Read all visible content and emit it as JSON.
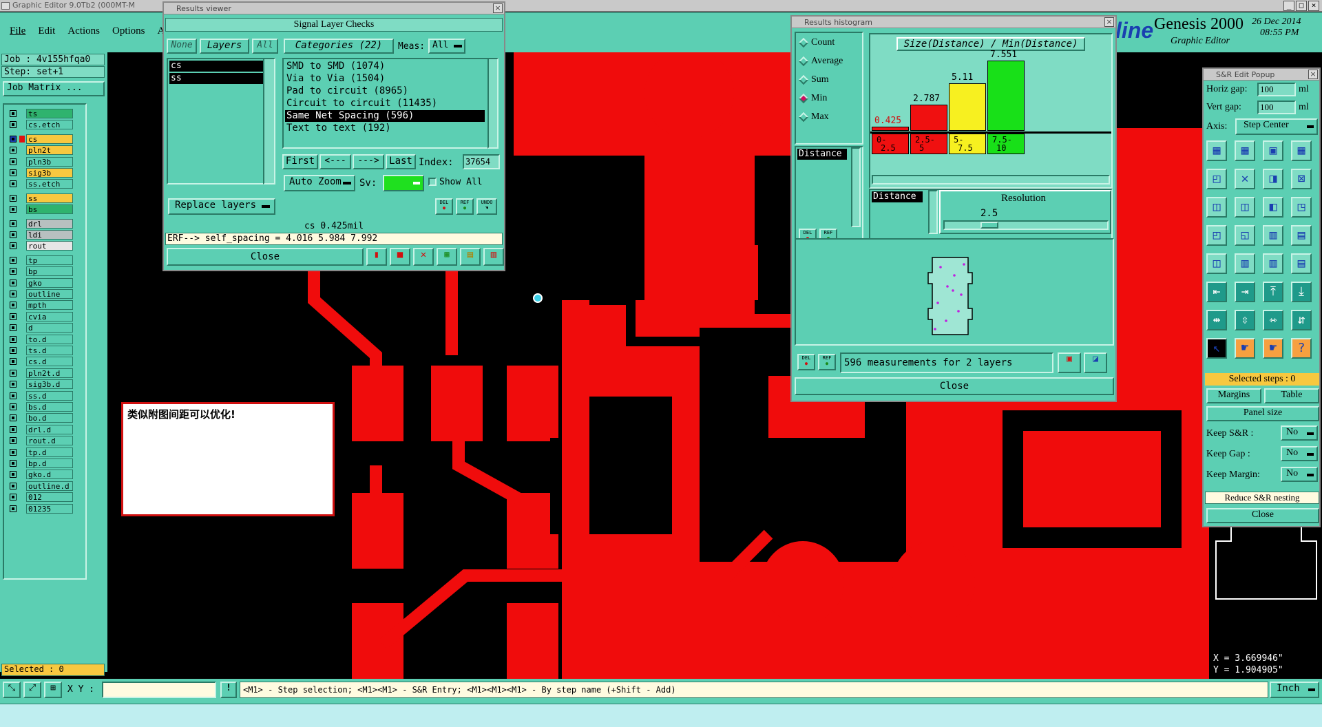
{
  "titlebar": {
    "title": "Graphic Editor 9.0Tb2 (000MT-M",
    "buttons": [
      "_",
      "□",
      "×"
    ]
  },
  "menu": {
    "items": [
      "File",
      "Edit",
      "Actions",
      "Options",
      "A"
    ]
  },
  "brand": {
    "logo_tail": "line",
    "product": "Genesis 2000",
    "subtitle": "Graphic Editor",
    "date": "26 Dec 2014",
    "time": "08:55 PM"
  },
  "left_panel": {
    "job": "Job : 4v155hfqa0",
    "step": "Step: set+1",
    "job_matrix": "Job Matrix ...",
    "layers": [
      {
        "name": "ts",
        "color": "#2fb36e"
      },
      {
        "name": "cs.etch",
        "color": "#5ccfb3"
      },
      {
        "name": "cs",
        "color": "#f7c840",
        "active": true
      },
      {
        "name": "pln2t",
        "color": "#f7c840"
      },
      {
        "name": "pln3b",
        "color": "#5ccfb3"
      },
      {
        "name": "sig3b",
        "color": "#f7c840"
      },
      {
        "name": "ss.etch",
        "color": "#5ccfb3"
      },
      {
        "name": "ss",
        "color": "#f7c840"
      },
      {
        "name": "bs",
        "color": "#2fb36e"
      },
      {
        "name": "drl",
        "color": "#b8c0c0"
      },
      {
        "name": "ldi",
        "color": "#b8c0c0"
      },
      {
        "name": "rout",
        "color": "#e6e6e6"
      },
      {
        "name": "tp",
        "color": "#5ccfb3"
      },
      {
        "name": "bp",
        "color": "#5ccfb3"
      },
      {
        "name": "gko",
        "color": "#5ccfb3"
      },
      {
        "name": "outline",
        "color": "#5ccfb3"
      },
      {
        "name": "mpth",
        "color": "#5ccfb3"
      },
      {
        "name": "cvia",
        "color": "#5ccfb3"
      },
      {
        "name": "d",
        "color": "#5ccfb3"
      },
      {
        "name": "to.d",
        "color": "#5ccfb3"
      },
      {
        "name": "ts.d",
        "color": "#5ccfb3"
      },
      {
        "name": "cs.d",
        "color": "#5ccfb3"
      },
      {
        "name": "pln2t.d",
        "color": "#5ccfb3"
      },
      {
        "name": "sig3b.d",
        "color": "#5ccfb3"
      },
      {
        "name": "ss.d",
        "color": "#5ccfb3"
      },
      {
        "name": "bs.d",
        "color": "#5ccfb3"
      },
      {
        "name": "bo.d",
        "color": "#5ccfb3"
      },
      {
        "name": "drl.d",
        "color": "#5ccfb3"
      },
      {
        "name": "rout.d",
        "color": "#5ccfb3"
      },
      {
        "name": "tp.d",
        "color": "#5ccfb3"
      },
      {
        "name": "bp.d",
        "color": "#5ccfb3"
      },
      {
        "name": "gko.d",
        "color": "#5ccfb3"
      },
      {
        "name": "outline.d",
        "color": "#5ccfb3"
      },
      {
        "name": "012",
        "color": "#5ccfb3"
      },
      {
        "name": "01235",
        "color": "#5ccfb3"
      }
    ],
    "selected": "Selected : 0"
  },
  "note": {
    "text": "类似附图间距可以优化!"
  },
  "results_viewer": {
    "title": "Results viewer",
    "header": "Signal Layer Checks",
    "none_btn": "None",
    "layers_btn": "Layers",
    "all_btn": "All",
    "categories_btn": "Categories (22)",
    "meas_label": "Meas:",
    "meas_value": "All",
    "layer_list": [
      "cs",
      "ss"
    ],
    "categories": [
      {
        "text": "SMD to SMD (1074)"
      },
      {
        "text": "Via to Via (1504)"
      },
      {
        "text": "Pad to circuit (8965)"
      },
      {
        "text": "Circuit to circuit (11435)"
      },
      {
        "text": "Same Net Spacing (596)",
        "selected": true
      },
      {
        "text": "Text to text (192)"
      }
    ],
    "nav": {
      "first": "First",
      "prev": "<---",
      "next": "--->",
      "last": "Last",
      "index_label": "Index:",
      "index_value": "37654"
    },
    "auto_zoom": "Auto Zoom",
    "sv_label": "Sv:",
    "show_all": "Show All",
    "replace_layers": "Replace layers",
    "small_btns": [
      "DEL",
      "REF",
      "UNDO"
    ],
    "status": "cs 0.425mil",
    "erf": "ERF--> self_spacing = 4.016 5.984 7.992",
    "close": "Close"
  },
  "histogram": {
    "title": "Results histogram",
    "modes": [
      {
        "label": "Count",
        "checked": false
      },
      {
        "label": "Average",
        "checked": false
      },
      {
        "label": "Sum",
        "checked": false
      },
      {
        "label": "Min",
        "checked": true
      },
      {
        "label": "Max",
        "checked": false
      }
    ],
    "chart_title": "Size(Distance) / Min(Distance)",
    "list_item": "Distance",
    "resolution_label": "Resolution",
    "resolution_list_item": "Distance",
    "resolution_value": "2.5",
    "measurements": "596 measurements for 2 layers",
    "small_btns": [
      "DEL",
      "REF"
    ],
    "close": "Close"
  },
  "chart_data": {
    "type": "bar",
    "title": "Size(Distance) / Min(Distance)",
    "categories": [
      "0-2.5",
      "2.5-5",
      "5-7.5",
      "7.5-10"
    ],
    "category_labels": [
      [
        "0-",
        "2.5"
      ],
      [
        "2.5-",
        "5"
      ],
      [
        "5-",
        "7.5"
      ],
      [
        "7.5-",
        "10"
      ]
    ],
    "values": [
      0.425,
      2.787,
      5.11,
      7.551
    ],
    "value_labels": [
      "0.425",
      "2.787",
      "5.11",
      "7.551"
    ],
    "colors": [
      "#f01010",
      "#f01010",
      "#f7f020",
      "#18e018"
    ],
    "ylim": [
      0,
      8
    ]
  },
  "sr_popup": {
    "title": "S&R Edit Popup",
    "horiz_gap_label": "Horiz gap:",
    "horiz_gap": "100",
    "horiz_unit": "ml",
    "vert_gap_label": "Vert  gap:",
    "vert_gap": "100",
    "vert_unit": "ml",
    "axis_label": "Axis:",
    "axis_value": "Step Center",
    "selected_steps": "Selected steps : 0",
    "margins": "Margins",
    "table": "Table",
    "panel_size": "Panel size",
    "keep_sr_label": "Keep S&R  :",
    "keep_sr": "No",
    "keep_gap_label": "Keep Gap   :",
    "keep_gap": "No",
    "keep_margin_label": "Keep Margin:",
    "keep_margin": "No",
    "reduce": "Reduce S&R nesting",
    "close": "Close"
  },
  "coords": {
    "x": "X = 3.669946\"",
    "y": "Y = 1.904905\""
  },
  "bottom": {
    "xy_label": "X Y :",
    "xy_value": "",
    "hint": "<M1> - Step selection; <M1><M1> - S&R Entry; <M1><M1><M1> - By step name (+Shift - Add)",
    "units": "Inch"
  }
}
